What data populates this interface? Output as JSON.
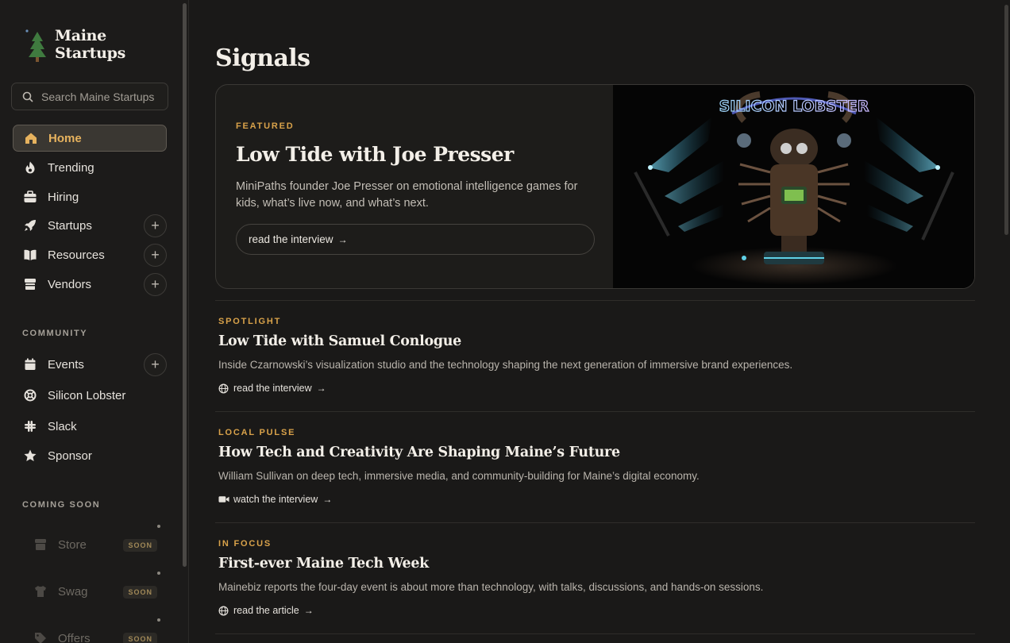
{
  "brand": {
    "name": "Maine Startups",
    "logo_icon": "pine-tree-icon"
  },
  "search": {
    "placeholder": "Search Maine Startups"
  },
  "colors": {
    "accent": "#d9a24a",
    "active_text": "#e6b25e",
    "background": "#1a1918"
  },
  "nav": {
    "items": [
      {
        "label": "Home",
        "icon": "home-icon",
        "active": true
      },
      {
        "label": "Trending",
        "icon": "flame-icon"
      },
      {
        "label": "Hiring",
        "icon": "briefcase-icon"
      },
      {
        "label": "Startups",
        "icon": "rocket-icon",
        "expandable": "+"
      },
      {
        "label": "Resources",
        "icon": "book-icon",
        "expandable": "+"
      },
      {
        "label": "Vendors",
        "icon": "store-icon",
        "expandable": "+"
      }
    ]
  },
  "community": {
    "label": "COMMUNITY",
    "items": [
      {
        "label": "Events",
        "icon": "calendar-icon",
        "expandable": "+"
      },
      {
        "label": "Silicon Lobster",
        "icon": "lifebuoy-icon"
      },
      {
        "label": "Slack",
        "icon": "slack-icon"
      },
      {
        "label": "Sponsor",
        "icon": "star-icon"
      }
    ]
  },
  "coming_soon": {
    "label": "COMING SOON",
    "items": [
      {
        "label": "Store",
        "badge": "SOON",
        "icon": "store-icon"
      },
      {
        "label": "Swag",
        "badge": "SOON",
        "icon": "shirt-icon"
      },
      {
        "label": "Offers",
        "badge": "SOON",
        "icon": "tag-icon"
      }
    ]
  },
  "page": {
    "title": "Signals"
  },
  "featured": {
    "kicker": "FEATURED",
    "title": "Low Tide with Joe Presser",
    "description": "MiniPaths founder Joe Presser on emotional intelligence games for kids, what’s live now, and what’s next.",
    "cta": "read the interview",
    "image_caption": "SILICON LOBSTER"
  },
  "articles": [
    {
      "kicker": "SPOTLIGHT",
      "title": "Low Tide with Samuel Conlogue",
      "summary": "Inside Czarnowski’s visualization studio and the technology shaping the next generation of immersive brand experiences.",
      "link": "read the interview",
      "link_icon": "globe-icon"
    },
    {
      "kicker": "LOCAL PULSE",
      "title": "How Tech and Creativity Are Shaping Maine’s Future",
      "summary": "William Sullivan on deep tech, immersive media, and community-building for Maine’s digital economy.",
      "link": "watch the interview",
      "link_icon": "video-icon"
    },
    {
      "kicker": "IN FOCUS",
      "title": "First-ever Maine Tech Week",
      "summary": "Mainebiz reports the four-day event is about more than technology, with talks, discussions, and hands-on sessions.",
      "link": "read the article",
      "link_icon": "globe-icon"
    }
  ]
}
